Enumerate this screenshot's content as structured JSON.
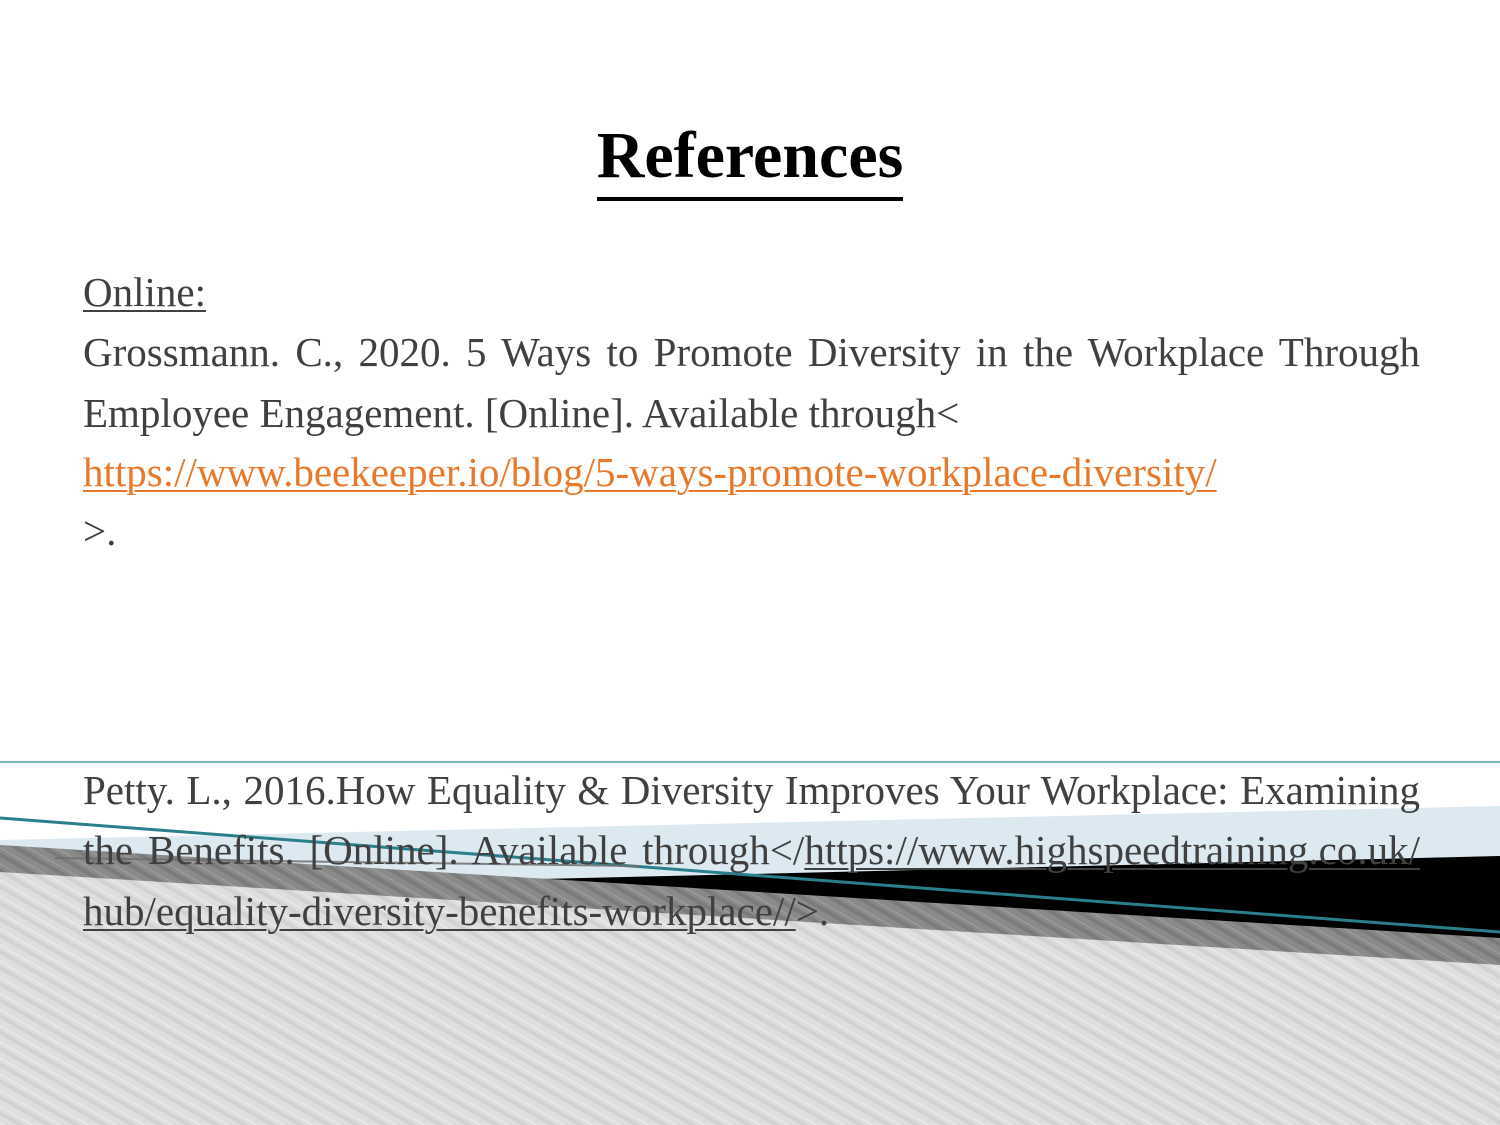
{
  "slide": {
    "title": "References ",
    "section_label": "Online: ",
    "accent_color": "#E8792B",
    "text_color": "#404040",
    "title_color": "#000000",
    "deco_teal": "#4D9AA6",
    "deco_lightblue": "#DCE9F0",
    "deco_black": "#000000",
    "deco_darkgray": "#808080",
    "deco_lightgray": "#DCDCDC",
    "background": "#FFFFFF"
  },
  "references": [
    {
      "id": "grossmann",
      "citation_part_1": "Grossmann. C., 2020. 5 Ways to Promote Diversity in the Workplace Through Employee Engagement. [Online]. Available through<",
      "url": "https://www.beekeeper.io/blog/5-ways-promote-workplace-diversity/",
      "citation_part_2": ">."
    },
    {
      "id": "petty",
      "citation_prefix": "Petty. L., 2016.How Equality & Diversity Improves Your Workplace: Examining the Benefits. [Online]. Available through</",
      "url": "https://www.highspeedtraining.co.uk/hub/equality-diversity-benefits-workplace//",
      "citation_suffix": ">."
    }
  ]
}
